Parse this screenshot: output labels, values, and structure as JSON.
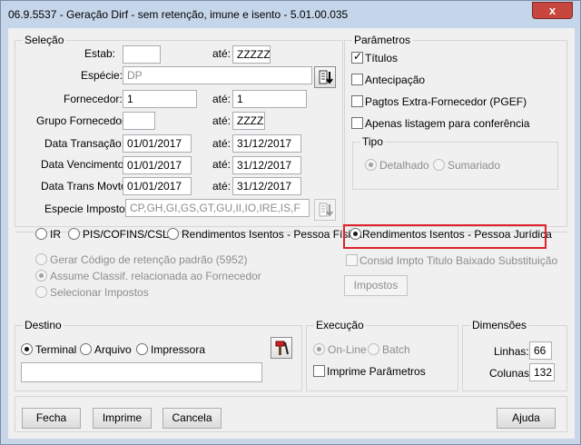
{
  "window": {
    "title": "06.9.5537 - Geração Dirf - sem retenção, imune e isento - 5.01.00.035",
    "close_glyph": "x"
  },
  "selecao": {
    "title": "Seleção",
    "estab_label": "Estab:",
    "estab_from": "",
    "ate": "até:",
    "estab_to": "ZZZZZ",
    "especie_label": "Espécie:",
    "especie_value": "DP",
    "fornecedor_label": "Fornecedor:",
    "fornecedor_from": "1",
    "fornecedor_to": "1",
    "grupo_label": "Grupo Fornecedor:",
    "grupo_from": "",
    "grupo_to": "ZZZZ",
    "data_transacao_label": "Data Transação:",
    "data_transacao_from": "01/01/2017",
    "data_transacao_to": "31/12/2017",
    "data_vencimento_label": "Data Vencimento:",
    "data_vencimento_from": "01/01/2017",
    "data_vencimento_to": "31/12/2017",
    "data_trans_movto_label": "Data Trans Movto:",
    "data_trans_movto_from": "01/01/2017",
    "data_trans_movto_to": "31/12/2017",
    "especie_imposto_label": "Especie Imposto:",
    "especie_imposto_value": "CP,GH,GI,GS,GT,GU,II,IO,IRE,IS,F"
  },
  "parametros": {
    "title": "Parâmetros",
    "titulos": {
      "label": "Títulos",
      "checked": true
    },
    "antecipacao": {
      "label": "Antecipação",
      "checked": false
    },
    "pagtos": {
      "label": "Pagtos Extra-Fornecedor (PGEF)",
      "checked": false
    },
    "apenas": {
      "label": "Apenas listagem para conferência",
      "checked": false
    },
    "tipo": {
      "title": "Tipo",
      "detalhado": "Detalhado",
      "sumariado": "Sumariado"
    }
  },
  "tributos": {
    "ir": "IR",
    "pis": "PIS/COFINS/CSLL",
    "rend_pf": "Rendimentos Isentos - Pessoa Física",
    "rend_pj": "Rendimentos Isentos - Pessoa Jurídica",
    "gerar_codigo": "Gerar Código de retenção padrão (5952)",
    "assume_classif": "Assume Classif. relacionada ao Fornecedor",
    "selecionar_impostos": "Selecionar Impostos",
    "consid_impto": "Consid Impto Titulo Baixado Substituição",
    "impostos_button": "Impostos"
  },
  "destino": {
    "title": "Destino",
    "terminal": "Terminal",
    "arquivo": "Arquivo",
    "impressora": "Impressora",
    "path": ""
  },
  "execucao": {
    "title": "Execução",
    "online": "On-Line",
    "batch": "Batch",
    "imprime": "Imprime Parâmetros"
  },
  "dimensoes": {
    "title": "Dimensões",
    "linhas_label": "Linhas:",
    "linhas": "66",
    "colunas_label": "Colunas:",
    "colunas": "132"
  },
  "footer": {
    "fecha": "Fecha",
    "imprime": "Imprime",
    "cancela": "Cancela",
    "ajuda": "Ajuda"
  },
  "colors": {
    "highlight": "#e0212b",
    "close_button": "#c7463d",
    "title_bar": "#c5d5ea"
  }
}
